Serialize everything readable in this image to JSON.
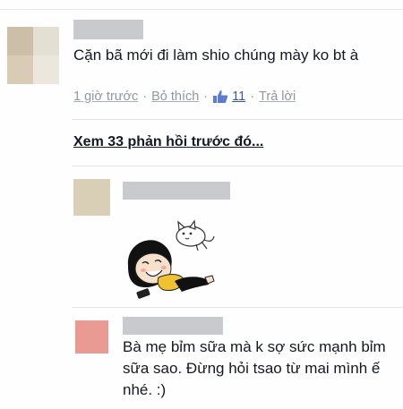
{
  "comments": [
    {
      "avatar_colors": [
        "#cbbfa8",
        "#d6cfbd",
        "#d9ccb6",
        "#e2dccd"
      ],
      "text": "Cặn bã mới đi làm shio chúng mày ko bt à",
      "meta": {
        "time": "1 giờ trước",
        "unlike": "Bỏ thích",
        "like_count": "11",
        "reply": "Trả lời",
        "separator": "·"
      }
    },
    {
      "avatar_color": "#d9cfb6",
      "sticker": "girl-with-cat-sticker"
    },
    {
      "avatar_color": "#e89a93",
      "text": "Bà mẹ bỉm sữa mà k sợ sức mạnh bỉm sữa sao. Đừng hỏi tsao từ mai mình ế nhé. :)"
    }
  ],
  "view_more": "Xem 33 phản hồi trước đó...",
  "colors": {
    "link_blue": "#3b5998",
    "meta_gray": "#9197a3",
    "redaction": "#c9cacd"
  }
}
